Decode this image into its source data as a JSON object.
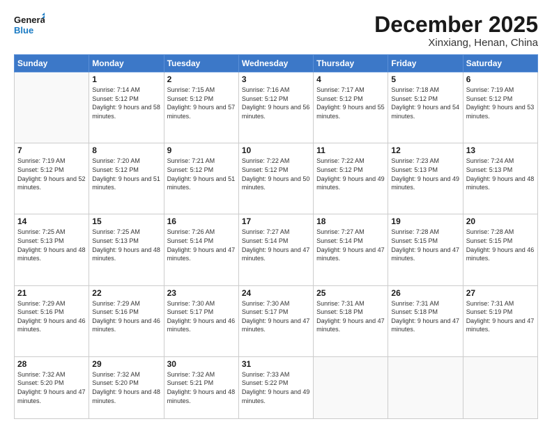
{
  "logo": {
    "line1": "General",
    "line2": "Blue"
  },
  "title": "December 2025",
  "subtitle": "Xinxiang, Henan, China",
  "weekdays": [
    "Sunday",
    "Monday",
    "Tuesday",
    "Wednesday",
    "Thursday",
    "Friday",
    "Saturday"
  ],
  "weeks": [
    [
      {
        "day": "",
        "sunrise": "",
        "sunset": "",
        "daylight": ""
      },
      {
        "day": "1",
        "sunrise": "7:14 AM",
        "sunset": "5:12 PM",
        "daylight": "9 hours and 58 minutes."
      },
      {
        "day": "2",
        "sunrise": "7:15 AM",
        "sunset": "5:12 PM",
        "daylight": "9 hours and 57 minutes."
      },
      {
        "day": "3",
        "sunrise": "7:16 AM",
        "sunset": "5:12 PM",
        "daylight": "9 hours and 56 minutes."
      },
      {
        "day": "4",
        "sunrise": "7:17 AM",
        "sunset": "5:12 PM",
        "daylight": "9 hours and 55 minutes."
      },
      {
        "day": "5",
        "sunrise": "7:18 AM",
        "sunset": "5:12 PM",
        "daylight": "9 hours and 54 minutes."
      },
      {
        "day": "6",
        "sunrise": "7:19 AM",
        "sunset": "5:12 PM",
        "daylight": "9 hours and 53 minutes."
      }
    ],
    [
      {
        "day": "7",
        "sunrise": "7:19 AM",
        "sunset": "5:12 PM",
        "daylight": "9 hours and 52 minutes."
      },
      {
        "day": "8",
        "sunrise": "7:20 AM",
        "sunset": "5:12 PM",
        "daylight": "9 hours and 51 minutes."
      },
      {
        "day": "9",
        "sunrise": "7:21 AM",
        "sunset": "5:12 PM",
        "daylight": "9 hours and 51 minutes."
      },
      {
        "day": "10",
        "sunrise": "7:22 AM",
        "sunset": "5:12 PM",
        "daylight": "9 hours and 50 minutes."
      },
      {
        "day": "11",
        "sunrise": "7:22 AM",
        "sunset": "5:12 PM",
        "daylight": "9 hours and 49 minutes."
      },
      {
        "day": "12",
        "sunrise": "7:23 AM",
        "sunset": "5:13 PM",
        "daylight": "9 hours and 49 minutes."
      },
      {
        "day": "13",
        "sunrise": "7:24 AM",
        "sunset": "5:13 PM",
        "daylight": "9 hours and 48 minutes."
      }
    ],
    [
      {
        "day": "14",
        "sunrise": "7:25 AM",
        "sunset": "5:13 PM",
        "daylight": "9 hours and 48 minutes."
      },
      {
        "day": "15",
        "sunrise": "7:25 AM",
        "sunset": "5:13 PM",
        "daylight": "9 hours and 48 minutes."
      },
      {
        "day": "16",
        "sunrise": "7:26 AM",
        "sunset": "5:14 PM",
        "daylight": "9 hours and 47 minutes."
      },
      {
        "day": "17",
        "sunrise": "7:27 AM",
        "sunset": "5:14 PM",
        "daylight": "9 hours and 47 minutes."
      },
      {
        "day": "18",
        "sunrise": "7:27 AM",
        "sunset": "5:14 PM",
        "daylight": "9 hours and 47 minutes."
      },
      {
        "day": "19",
        "sunrise": "7:28 AM",
        "sunset": "5:15 PM",
        "daylight": "9 hours and 47 minutes."
      },
      {
        "day": "20",
        "sunrise": "7:28 AM",
        "sunset": "5:15 PM",
        "daylight": "9 hours and 46 minutes."
      }
    ],
    [
      {
        "day": "21",
        "sunrise": "7:29 AM",
        "sunset": "5:16 PM",
        "daylight": "9 hours and 46 minutes."
      },
      {
        "day": "22",
        "sunrise": "7:29 AM",
        "sunset": "5:16 PM",
        "daylight": "9 hours and 46 minutes."
      },
      {
        "day": "23",
        "sunrise": "7:30 AM",
        "sunset": "5:17 PM",
        "daylight": "9 hours and 46 minutes."
      },
      {
        "day": "24",
        "sunrise": "7:30 AM",
        "sunset": "5:17 PM",
        "daylight": "9 hours and 47 minutes."
      },
      {
        "day": "25",
        "sunrise": "7:31 AM",
        "sunset": "5:18 PM",
        "daylight": "9 hours and 47 minutes."
      },
      {
        "day": "26",
        "sunrise": "7:31 AM",
        "sunset": "5:18 PM",
        "daylight": "9 hours and 47 minutes."
      },
      {
        "day": "27",
        "sunrise": "7:31 AM",
        "sunset": "5:19 PM",
        "daylight": "9 hours and 47 minutes."
      }
    ],
    [
      {
        "day": "28",
        "sunrise": "7:32 AM",
        "sunset": "5:20 PM",
        "daylight": "9 hours and 47 minutes."
      },
      {
        "day": "29",
        "sunrise": "7:32 AM",
        "sunset": "5:20 PM",
        "daylight": "9 hours and 48 minutes."
      },
      {
        "day": "30",
        "sunrise": "7:32 AM",
        "sunset": "5:21 PM",
        "daylight": "9 hours and 48 minutes."
      },
      {
        "day": "31",
        "sunrise": "7:33 AM",
        "sunset": "5:22 PM",
        "daylight": "9 hours and 49 minutes."
      },
      {
        "day": "",
        "sunrise": "",
        "sunset": "",
        "daylight": ""
      },
      {
        "day": "",
        "sunrise": "",
        "sunset": "",
        "daylight": ""
      },
      {
        "day": "",
        "sunrise": "",
        "sunset": "",
        "daylight": ""
      }
    ]
  ],
  "labels": {
    "sunrise": "Sunrise:",
    "sunset": "Sunset:",
    "daylight": "Daylight:"
  }
}
